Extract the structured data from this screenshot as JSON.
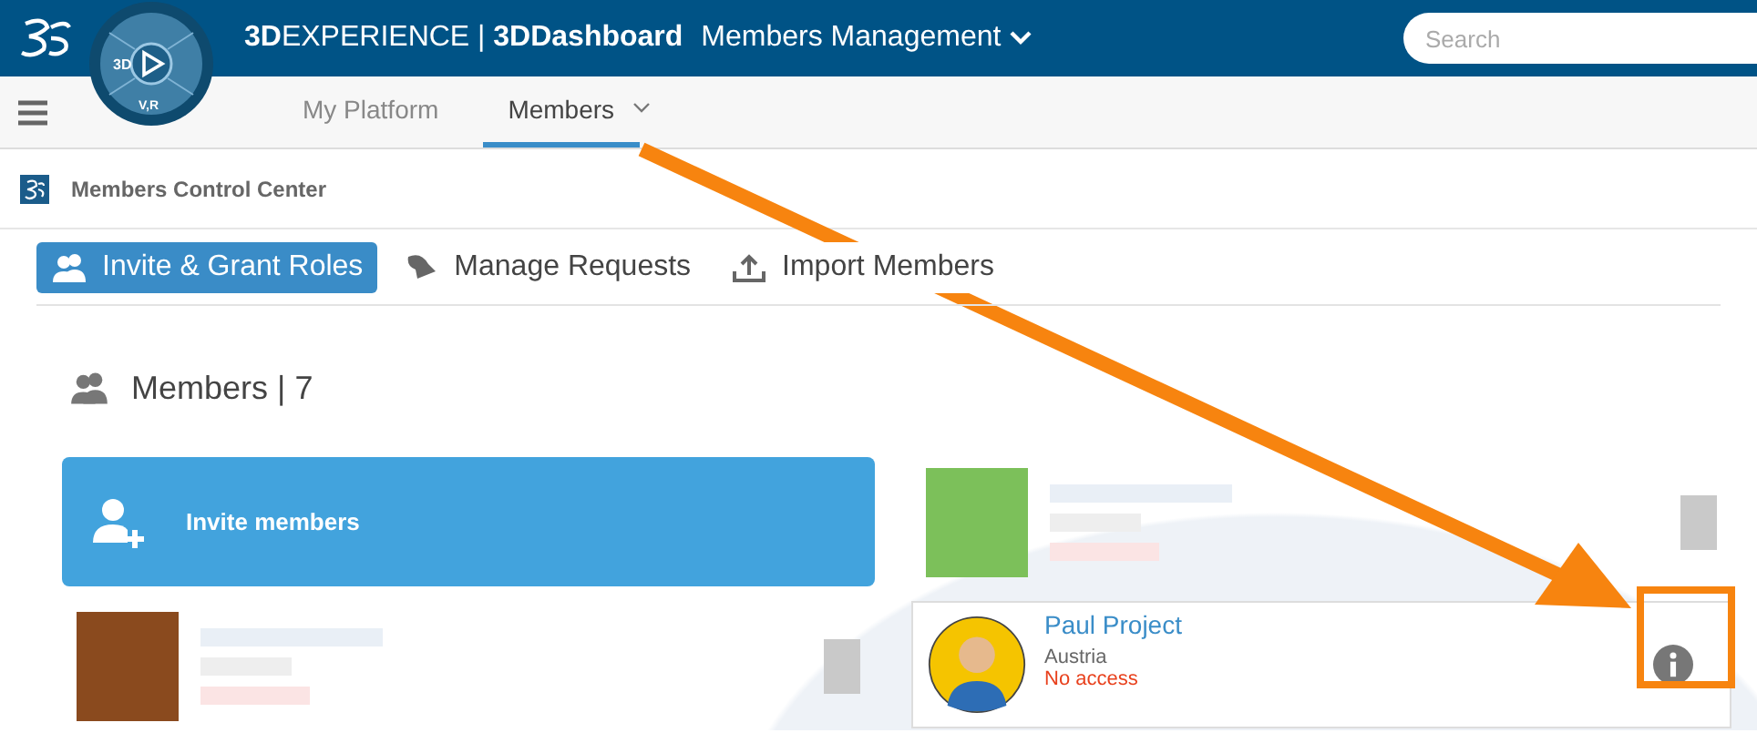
{
  "header": {
    "brand": "**3D**EXPERIENCE | **3DDashboard**",
    "app_title": "Members Management",
    "compass_labels": [
      "3D",
      "V,R"
    ],
    "search": {
      "placeholder": "Search"
    }
  },
  "tabs": [
    {
      "label": "My Platform",
      "selected": false
    },
    {
      "label": "Members",
      "selected": true
    }
  ],
  "widget_title": "Members Control Center",
  "toolbar": [
    {
      "label": "Invite & Grant Roles",
      "kind": "invite",
      "selected": true
    },
    {
      "label": "Manage Requests",
      "kind": "requests",
      "selected": false
    },
    {
      "label": "Import Members",
      "kind": "import",
      "selected": false
    }
  ],
  "members_heading": "Members | 7",
  "cards": [
    {
      "kind": "invite",
      "label": "Invite members"
    },
    {
      "kind": "redacted",
      "color": "#7cc05a"
    },
    {
      "kind": "redacted",
      "color": "#8a4a1e"
    },
    {
      "kind": "member",
      "name": "Paul Project",
      "country": "Austria",
      "status": "No access"
    }
  ]
}
